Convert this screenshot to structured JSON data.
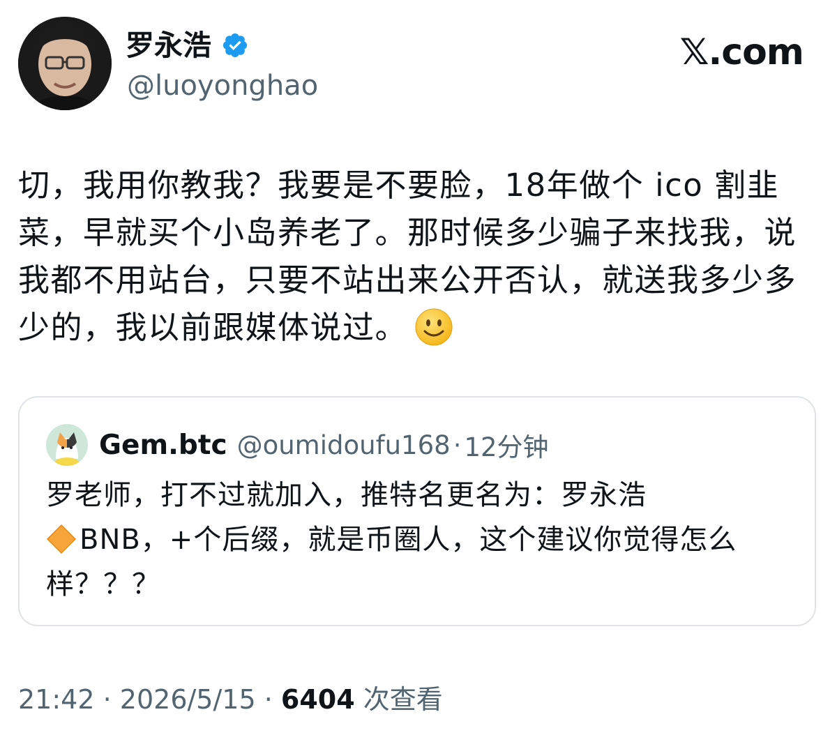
{
  "author": {
    "name": "罗永浩",
    "handle": "@luoyonghao",
    "verified_color": "#1d9bf0"
  },
  "brand": {
    "logo_text": "𝕏.com"
  },
  "tweet": {
    "text": "切，我用你教我？我要是不要脸，18年做个 ico 割韭菜，早就买个小岛养老了。那时候多少骗子来找我，说我都不用站台，只要不站出来公开否认，就送我多少多少的，我以前跟媒体说过。",
    "emoji": "smiley-face-icon"
  },
  "quote": {
    "name": "Gem.btc",
    "handle": "@oumidoufu168",
    "separator": "·",
    "time": "12分钟",
    "text_line1": "罗老师，打不过就加入，推特名更名为：罗永浩",
    "diamond_icon": "orange-diamond-icon",
    "text_rest": "BNB，+个后缀，就是币圈人，这个建议你觉得怎么样？？？"
  },
  "meta": {
    "time": "21:42",
    "sep1": "·",
    "date": "2026/5/15",
    "sep2": "·",
    "views": "6404",
    "views_label": "次查看"
  }
}
